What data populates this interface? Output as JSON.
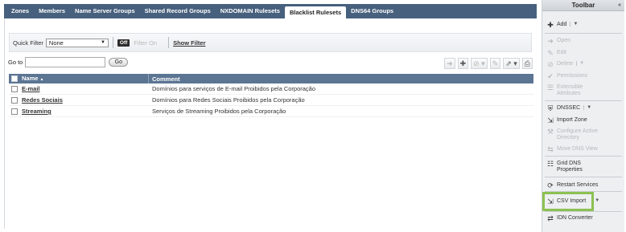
{
  "tabs": [
    {
      "label": "Zones",
      "active": false
    },
    {
      "label": "Members",
      "active": false
    },
    {
      "label": "Name Server Groups",
      "active": false
    },
    {
      "label": "Shared Record Groups",
      "active": false
    },
    {
      "label": "NXDOMAIN Rulesets",
      "active": false
    },
    {
      "label": "Blacklist Rulesets",
      "active": true
    },
    {
      "label": "DNS64 Groups",
      "active": false
    }
  ],
  "filter": {
    "label": "Quick Filter",
    "selected": "None",
    "toggle": "Off",
    "filter_on": "Filter On",
    "show_filter": "Show Filter"
  },
  "goto": {
    "label": "Go to",
    "value": "",
    "button": "Go"
  },
  "grid": {
    "columns": [
      "Name",
      "Comment"
    ],
    "sort_indicator": "▲",
    "rows": [
      {
        "name": "E-mail",
        "comment": "Domínios para serviços de E-mail Proibidos pela Corporação"
      },
      {
        "name": "Redes Sociais",
        "comment": "Domínios para Redes Sociais Proibidos pela Corporação"
      },
      {
        "name": "Streaming",
        "comment": "Serviços de Streaming Proibidos pela Corporação"
      }
    ]
  },
  "toolbar": {
    "title": "Toolbar",
    "collapse": "«",
    "items": [
      {
        "label": "Add",
        "icon": "plus-icon",
        "enabled": true
      },
      {
        "label": "Open",
        "icon": "arrow-right-icon",
        "enabled": false
      },
      {
        "label": "Edit",
        "icon": "edit-icon",
        "enabled": false
      },
      {
        "label": "Delete",
        "icon": "delete-icon",
        "enabled": false
      },
      {
        "label": "Permissions",
        "icon": "check-icon",
        "enabled": false
      },
      {
        "label": "Extensible Attributes",
        "icon": "list-icon",
        "enabled": false
      },
      {
        "label": "DNSSEC",
        "icon": "shield-icon",
        "enabled": true
      },
      {
        "label": "Import Zone",
        "icon": "import-icon",
        "enabled": true
      },
      {
        "label": "Configure Active Directory",
        "icon": "wrench-icon",
        "enabled": false
      },
      {
        "label": "Move DNS View",
        "icon": "move-icon",
        "enabled": false
      },
      {
        "label": "Grid DNS Properties",
        "icon": "properties-icon",
        "enabled": true
      },
      {
        "label": "Restart Services",
        "icon": "restart-icon",
        "enabled": true
      },
      {
        "label": "CSV Import",
        "icon": "csv-import-icon",
        "enabled": true
      },
      {
        "label": "IDN Converter",
        "icon": "converter-icon",
        "enabled": true
      }
    ]
  },
  "colors": {
    "tabbar": "#46607d",
    "grid_header": "#5b7593",
    "highlight": "#8cc152"
  }
}
